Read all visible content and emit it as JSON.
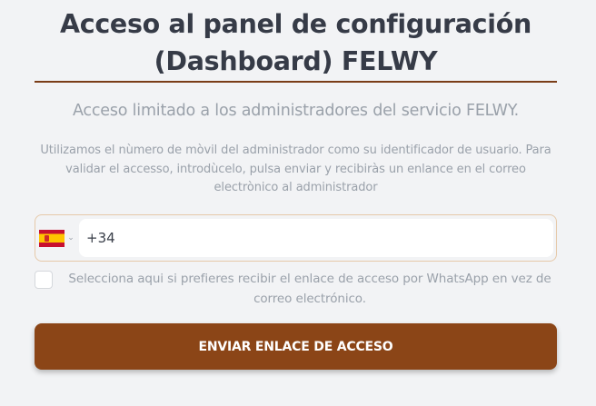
{
  "header": {
    "title": "Acceso al panel de configuración (Dashboard) FELWY",
    "subtitle": "Acceso limitado a los administradores del servicio FELWY.",
    "description": "Utilizamos el nùmero de mòvil del administrador como su identificador de usuario. Para validar el accesso, introdùcelo, pulsa enviar y recibiràs un enlance en el correo electrònico al administrador"
  },
  "form": {
    "country_flag": "spain-flag-icon",
    "phone_value": "+34",
    "whatsapp_label": "Selecciona aqui si prefieres recibir el enlace de acceso por WhatsApp en vez de correo electrónico.",
    "whatsapp_checked": false,
    "submit_label": "ENVIAR ENLACE DE ACCESO"
  },
  "colors": {
    "accent": "#8b4517",
    "divider": "#7a3d17",
    "title": "#363b47",
    "muted_text": "#9aa1aa",
    "background": "#f2f3f5"
  }
}
